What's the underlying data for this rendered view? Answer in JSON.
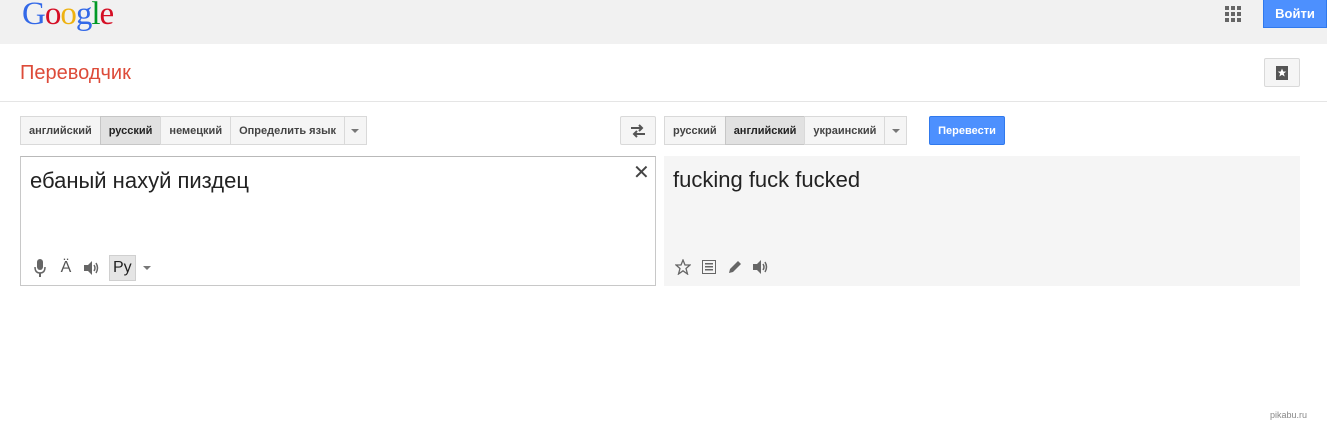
{
  "header": {
    "logo_letters": [
      {
        "char": "G",
        "color": "#3369e8"
      },
      {
        "char": "o",
        "color": "#d50f25"
      },
      {
        "char": "o",
        "color": "#eeb211"
      },
      {
        "char": "g",
        "color": "#3369e8"
      },
      {
        "char": "l",
        "color": "#009925"
      },
      {
        "char": "e",
        "color": "#d50f25"
      }
    ],
    "apps_icon": "apps-grid-icon",
    "signin_label": "Войти"
  },
  "subheader": {
    "title": "Переводчик",
    "phrasebook_icon": "phrasebook-star-icon"
  },
  "source_langs": {
    "items": [
      "английский",
      "русский",
      "немецкий",
      "Определить язык"
    ],
    "selected": "русский"
  },
  "target_langs": {
    "items": [
      "русский",
      "английский",
      "украинский"
    ],
    "selected": "английский"
  },
  "swap_icon": "swap-languages-icon",
  "translate_button": "Перевести",
  "source": {
    "text": "ебаный нахуй пиздец",
    "clear_icon": "close-icon",
    "input_tool_label": "Ру"
  },
  "result": {
    "text": "fucking fuck fucked"
  },
  "watermark": "pikabu.ru",
  "colors": {
    "accent_blue": "#4d90fe",
    "title_red": "#dd4b39",
    "topbar_gray": "#f1f1f1"
  }
}
